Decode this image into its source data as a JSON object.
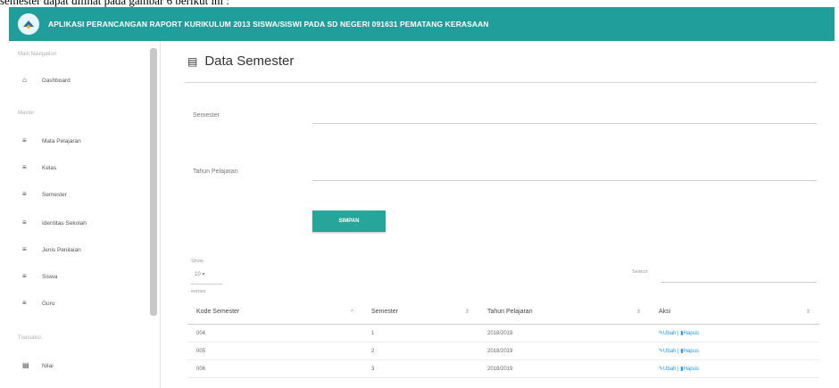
{
  "caption": "semester dapat dilihat pada gambar 6 berikut ini :",
  "header": {
    "app_title": "APLIKASI PERANCANGAN RAPORT KURIKULUM 2013 SISWA/SISWI PADA SD NEGERI 091631 PEMATANG KERASAAN"
  },
  "sidebar": {
    "section_main": "Main Navigation",
    "dashboard": "Dashboard",
    "section_master": "Master",
    "items": [
      "Mata Pelajaran",
      "Kelas",
      "Semester",
      "Identitas Sekolah",
      "Jenis Penilaian",
      "Siswa",
      "Guru"
    ],
    "section_transaksi": "Transaksi",
    "nilai": "Nilai"
  },
  "page": {
    "title": "Data Semester",
    "label_semester": "Semester",
    "label_tahun": "Tahun Pelajaran",
    "save_button": "SIMPAN",
    "show_label": "Show",
    "show_value": "10",
    "entries_label": "entries",
    "search_label": "Search:"
  },
  "table": {
    "headers": [
      "Kode Semester",
      "Semester",
      "Tahun Pelajaran",
      "Aksi"
    ],
    "rows": [
      {
        "kode": "004",
        "semester": "1",
        "tahun": "2018/2019",
        "edit": "Ubah",
        "delete": "Hapus"
      },
      {
        "kode": "005",
        "semester": "2",
        "tahun": "2018/2019",
        "edit": "Ubah",
        "delete": "Hapus"
      },
      {
        "kode": "006",
        "semester": "3",
        "tahun": "2018/2019",
        "edit": "Ubah",
        "delete": "Hapus"
      }
    ]
  },
  "colors": {
    "accent": "#1f9e9b",
    "button": "#26a69a",
    "link": "#2196f3"
  }
}
